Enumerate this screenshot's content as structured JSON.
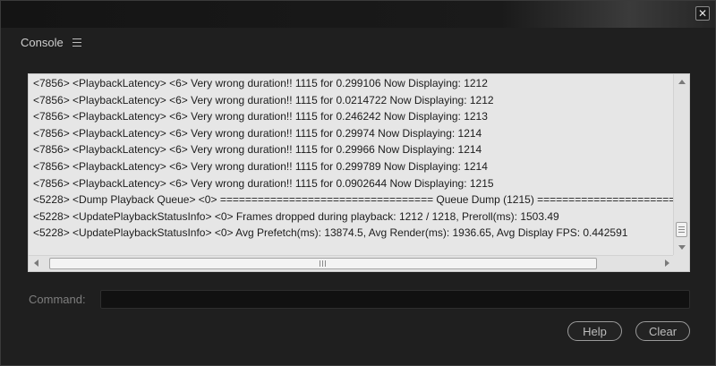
{
  "window": {
    "close_glyph": "✕"
  },
  "panel": {
    "title": "Console",
    "menu_icon": "hamburger-icon"
  },
  "log": {
    "lines": [
      "<7856> <PlaybackLatency> <6> Very wrong duration!! 1115 for 0.299106 Now Displaying: 1212",
      "<7856> <PlaybackLatency> <6> Very wrong duration!! 1115 for 0.0214722 Now Displaying: 1212",
      "<7856> <PlaybackLatency> <6> Very wrong duration!! 1115 for 0.246242 Now Displaying: 1213",
      "<7856> <PlaybackLatency> <6> Very wrong duration!! 1115 for 0.29974 Now Displaying: 1214",
      "<7856> <PlaybackLatency> <6> Very wrong duration!! 1115 for 0.29966 Now Displaying: 1214",
      "<7856> <PlaybackLatency> <6> Very wrong duration!! 1115 for 0.299789 Now Displaying: 1214",
      "<7856> <PlaybackLatency> <6> Very wrong duration!! 1115 for 0.0902644 Now Displaying: 1215",
      "<5228> <Dump Playback Queue> <0> ================================== Queue Dump (1215) ================================",
      "<5228> <UpdatePlaybackStatusInfo> <0>  Frames dropped during playback: 1212 / 1218, Preroll(ms): 1503.49",
      "<5228> <UpdatePlaybackStatusInfo> <0> Avg Prefetch(ms): 13874.5, Avg Render(ms): 1936.65, Avg Display FPS: 0.442591"
    ]
  },
  "scrollbars": {
    "vertical_position": 1.0,
    "horizontal_position": 0.0
  },
  "command": {
    "label": "Command:",
    "value": "",
    "placeholder": ""
  },
  "buttons": {
    "help_label": "Help",
    "clear_label": "Clear"
  },
  "colors": {
    "window_bg": "#1f1f1f",
    "console_bg": "#e6e6e6",
    "log_text": "#1c1c1c",
    "label_text": "#7e7e7e",
    "button_border": "#9a9a9a"
  }
}
